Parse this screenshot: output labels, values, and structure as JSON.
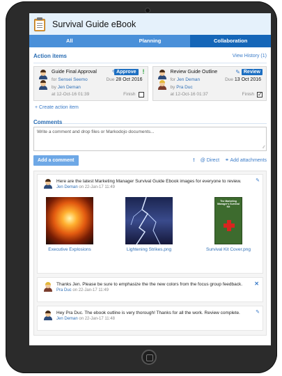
{
  "app": {
    "title": "Survival Guide eBook"
  },
  "tabs": [
    {
      "label": "All"
    },
    {
      "label": "Planning"
    },
    {
      "label": "Collaboration"
    }
  ],
  "action_items": {
    "section_title": "Action items",
    "view_history": "View History (1)",
    "create_link": "Create action item",
    "items": [
      {
        "title": "Guide Final Approval",
        "for_prefix": "for",
        "for_name": "Sensei Seemo",
        "by_prefix": "by",
        "by_name": "Jen Deman",
        "at": "at 12-Oct-16 01:39",
        "status": "Approve",
        "due_prefix": "Due",
        "due_date": "28 Oct 2016",
        "finish_label": "Finish",
        "finished": false,
        "priority_mark": "!"
      },
      {
        "title": "Review Guide Outline",
        "for_prefix": "for",
        "for_name": "Jen Deman",
        "by_prefix": "by",
        "by_name": "Pra Duc",
        "at": "at 12-Oct-16 01:37",
        "status": "Review",
        "due_prefix": "Due",
        "due_date": "13 Oct 2016",
        "finish_label": "Finish",
        "finished": true
      }
    ]
  },
  "comments": {
    "section_title": "Comments",
    "placeholder": "Write a comment and drop files or Markodojo documents...",
    "add_button": "Add a comment",
    "priority": "!",
    "direct": "@ Direct",
    "attach": "Add attachments",
    "posts": [
      {
        "text": "Here are the latest Marketing Manager Survival Guide Ebook images for everyone to review.",
        "author": "Jen Deman",
        "when": "on 22-Jan-17 11:49",
        "images": [
          {
            "caption": "Executive Explosions",
            "kind": "explosion-photo"
          },
          {
            "caption": "Lightening Strikes.png",
            "kind": "lightning-photo"
          },
          {
            "caption": "Survival Kit Cover.png",
            "kind": "ebook-cover",
            "cover_title": "The Marketing Manager's Survival Kit"
          }
        ]
      },
      {
        "text": "Thanks Jen. Please be sure to emphasize the the new colors from the focus group feedback.",
        "author": "Pra Duc",
        "when": "on 22-Jan-17 11:49"
      },
      {
        "text": "Hey Pra Duc. The ebook outline is very thorough! Thanks for all the work. Review complete.",
        "author": "Jen Deman",
        "when": "on 22-Jan-17 11:48"
      }
    ]
  },
  "colors": {
    "accent": "#1566b8",
    "tab_bar": "#4a90d9",
    "link": "#2f6fb6",
    "approve_mark": "#2aa33a"
  }
}
